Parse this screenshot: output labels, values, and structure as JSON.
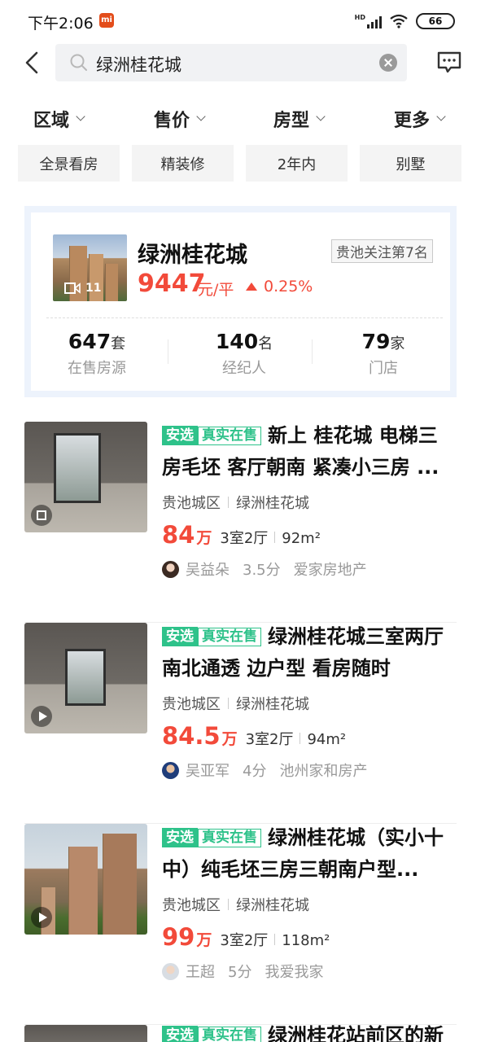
{
  "status_bar": {
    "time": "下午2:06",
    "mi_logo": "mi",
    "battery": "66",
    "hd_label": "HD"
  },
  "search": {
    "value": "绿洲桂花城"
  },
  "filters": [
    {
      "label": "区域"
    },
    {
      "label": "售价"
    },
    {
      "label": "房型"
    },
    {
      "label": "更多"
    }
  ],
  "quick_tags": [
    {
      "label": "全景看房"
    },
    {
      "label": "精装修"
    },
    {
      "label": "2年内"
    },
    {
      "label": "别墅"
    }
  ],
  "community": {
    "name": "绿洲桂花城",
    "rank": "贵池关注第7名",
    "photo_count": "11",
    "price": "9447",
    "price_unit": "元/平",
    "change": "0.25%",
    "stats": [
      {
        "num": "647",
        "unit": "套",
        "label": "在售房源"
      },
      {
        "num": "140",
        "unit": "名",
        "label": "经纪人"
      },
      {
        "num": "79",
        "unit": "家",
        "label": "门店"
      }
    ]
  },
  "tags": {
    "anxuan": "安选",
    "real": "真实在售"
  },
  "listings": [
    {
      "title": "新上 桂花城 电梯三房毛坯 客厅朝南 紧凑小三房 ...",
      "district": "贵池城区",
      "community": "绿洲桂花城",
      "price": "84",
      "price_unit": "万",
      "rooms": "3室2厅",
      "area": "92m²",
      "agent": "吴益朵",
      "score": "3.5分",
      "company": "爱家房地产",
      "badge_icon": "crop-icon"
    },
    {
      "title": "绿洲桂花城三室两厅 南北通透 边户型 看房随时",
      "district": "贵池城区",
      "community": "绿洲桂花城",
      "price": "84.5",
      "price_unit": "万",
      "rooms": "3室2厅",
      "area": "94m²",
      "agent": "吴亚军",
      "score": "4分",
      "company": "池州家和房产",
      "badge_icon": "play-icon"
    },
    {
      "title": "绿洲桂花城（实小十中）纯毛坯三房三朝南户型...",
      "district": "贵池城区",
      "community": "绿洲桂花城",
      "price": "99",
      "price_unit": "万",
      "rooms": "3室2厅",
      "area": "118m²",
      "agent": "王超",
      "score": "5分",
      "company": "我爱我家",
      "badge_icon": "play-icon"
    },
    {
      "title": "绿洲桂花站前区的新"
    }
  ],
  "colors": {
    "accent_red": "#f24a3a",
    "tag_green": "#2ec28a",
    "card_bg": "#edf3fc"
  }
}
